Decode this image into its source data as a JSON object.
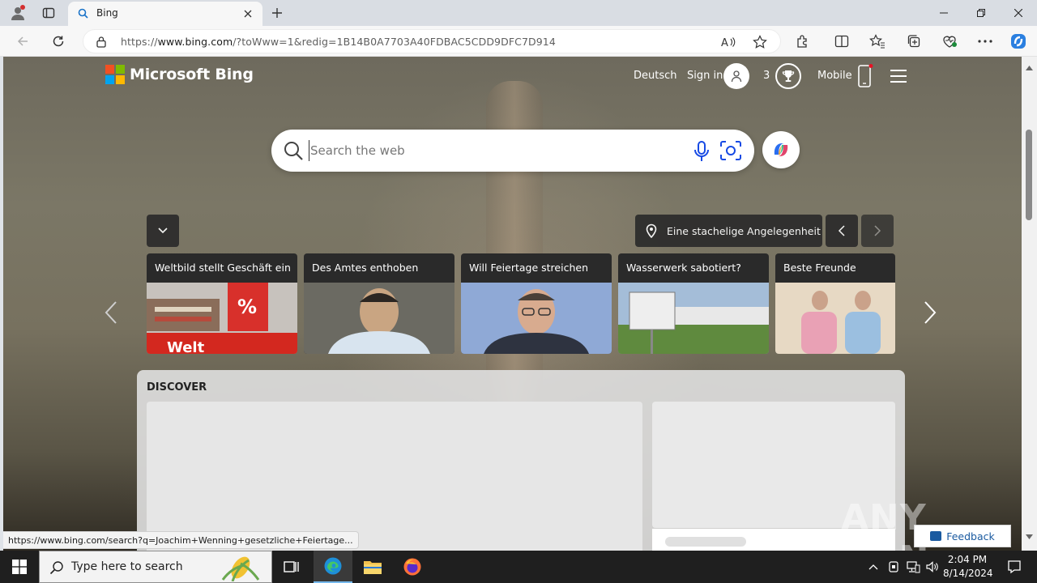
{
  "browser": {
    "tab_title": "Bing",
    "url_prefix": "https://",
    "url_host": "www.bing.com",
    "url_rest": "/?toWww=1&redig=1B14B0A7703A40FDBAC5CDD9DFC7D914"
  },
  "header": {
    "logo_text": "Microsoft Bing",
    "language": "Deutsch",
    "sign_in": "Sign in",
    "rewards_count": "3",
    "mobile": "Mobile"
  },
  "search": {
    "placeholder": "Search the web"
  },
  "carousel": {
    "location_title": "Eine stachelige Angelegenheit",
    "cards": [
      {
        "title": "Weltbild stellt Geschäft ein"
      },
      {
        "title": "Des Amtes enthoben"
      },
      {
        "title": "Will Feiertage streichen"
      },
      {
        "title": "Wasserwerk sabotiert?"
      },
      {
        "title": "Beste Freunde"
      }
    ]
  },
  "discover": {
    "title": "DISCOVER"
  },
  "feedback": "Feedback",
  "watermark": "ANY RUN",
  "status_bar_url": "https://www.bing.com/search?q=Joachim+Wenning+gesetzliche+Feiertage...",
  "taskbar": {
    "search_placeholder": "Type here to search",
    "time": "2:04 PM",
    "date": "8/14/2024"
  },
  "colors": {
    "windows_logo": [
      "#f25022",
      "#7fba00",
      "#00a4ef",
      "#ffb900"
    ],
    "accent": "#0078d4"
  }
}
